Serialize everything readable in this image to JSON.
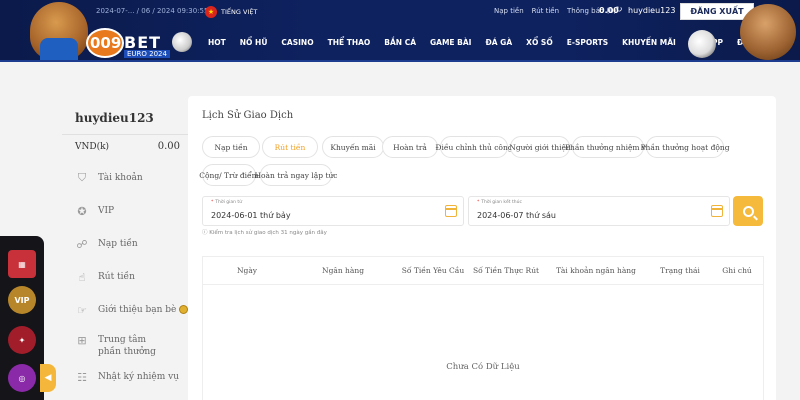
{
  "header": {
    "datetime": "2024-07-... / 06 / 2024 09:30:55",
    "language": "TIẾNG VIỆT",
    "top_links": [
      "Nạp tiền",
      "Rút tiền",
      "Thông báo (0)"
    ],
    "balance": "0.00",
    "username": "huydieu123",
    "logout_label": "ĐĂNG XUẤT",
    "logo_text": "009BET",
    "logo_sub": "EURO 2024",
    "nav": [
      "HOT",
      "NỔ HŨ",
      "CASINO",
      "THỂ THAO",
      "BẮN CÁ",
      "GAME BÀI",
      "ĐÁ GÀ",
      "XỔ SỐ",
      "E-SPORTS",
      "KHUYẾN MÃI",
      "TẢI APP",
      "ĐẠI LÝ"
    ]
  },
  "account": {
    "username": "huydieu123",
    "currency": "VND(k)",
    "amount": "0.00",
    "menu": [
      {
        "label": "Tài khoản",
        "icon": "shield-icon"
      },
      {
        "label": "VIP",
        "icon": "star-icon"
      },
      {
        "label": "Nạp tiền",
        "icon": "deposit-icon"
      },
      {
        "label": "Rút tiền",
        "icon": "withdraw-icon"
      },
      {
        "label": "Giới thiệu bạn bè",
        "icon": "referral-icon"
      },
      {
        "label": "Trung tâm phần thưởng",
        "icon": "gift-icon"
      },
      {
        "label": "Nhật ký nhiệm vụ",
        "icon": "notebook-icon"
      }
    ]
  },
  "float_widget": {
    "items": [
      "calendar-icon",
      "vip-icon",
      "reward-icon",
      "wheel-icon"
    ],
    "vip_label": "VIP"
  },
  "panel": {
    "title": "Lịch Sử Giao Dịch",
    "tabs": [
      "Nạp tiền",
      "Rút tiền",
      "Khuyến mãi",
      "Hoàn trả",
      "Điều chỉnh thủ công",
      "Người giới thiệu",
      "Phần thưởng nhiệm vụ",
      "Phần thưởng hoạt động",
      "Cộng/ Trừ điểm",
      "Hoàn trả ngay lập tức"
    ],
    "active_tab": "Rút tiền",
    "start_label": "Thời gian từ",
    "start_value": "2024-06-01 thứ bảy",
    "end_label": "Thời gian kết thúc",
    "end_value": "2024-06-07 thứ sáu",
    "note": "ⓘ Kiểm tra lịch sử giao dịch 31 ngày gần đây",
    "columns": [
      "Ngày",
      "Ngân hàng",
      "Số Tiền Yêu Cầu",
      "Số Tiền Thực Rút",
      "Tài khoản ngân hàng",
      "Trạng thái",
      "Ghi chú"
    ],
    "empty_text": "Chưa Có Dữ Liệu"
  },
  "colors": {
    "header_bg": "#0e2260",
    "accent": "#f5b93c",
    "active_tab": "#f0a020"
  }
}
